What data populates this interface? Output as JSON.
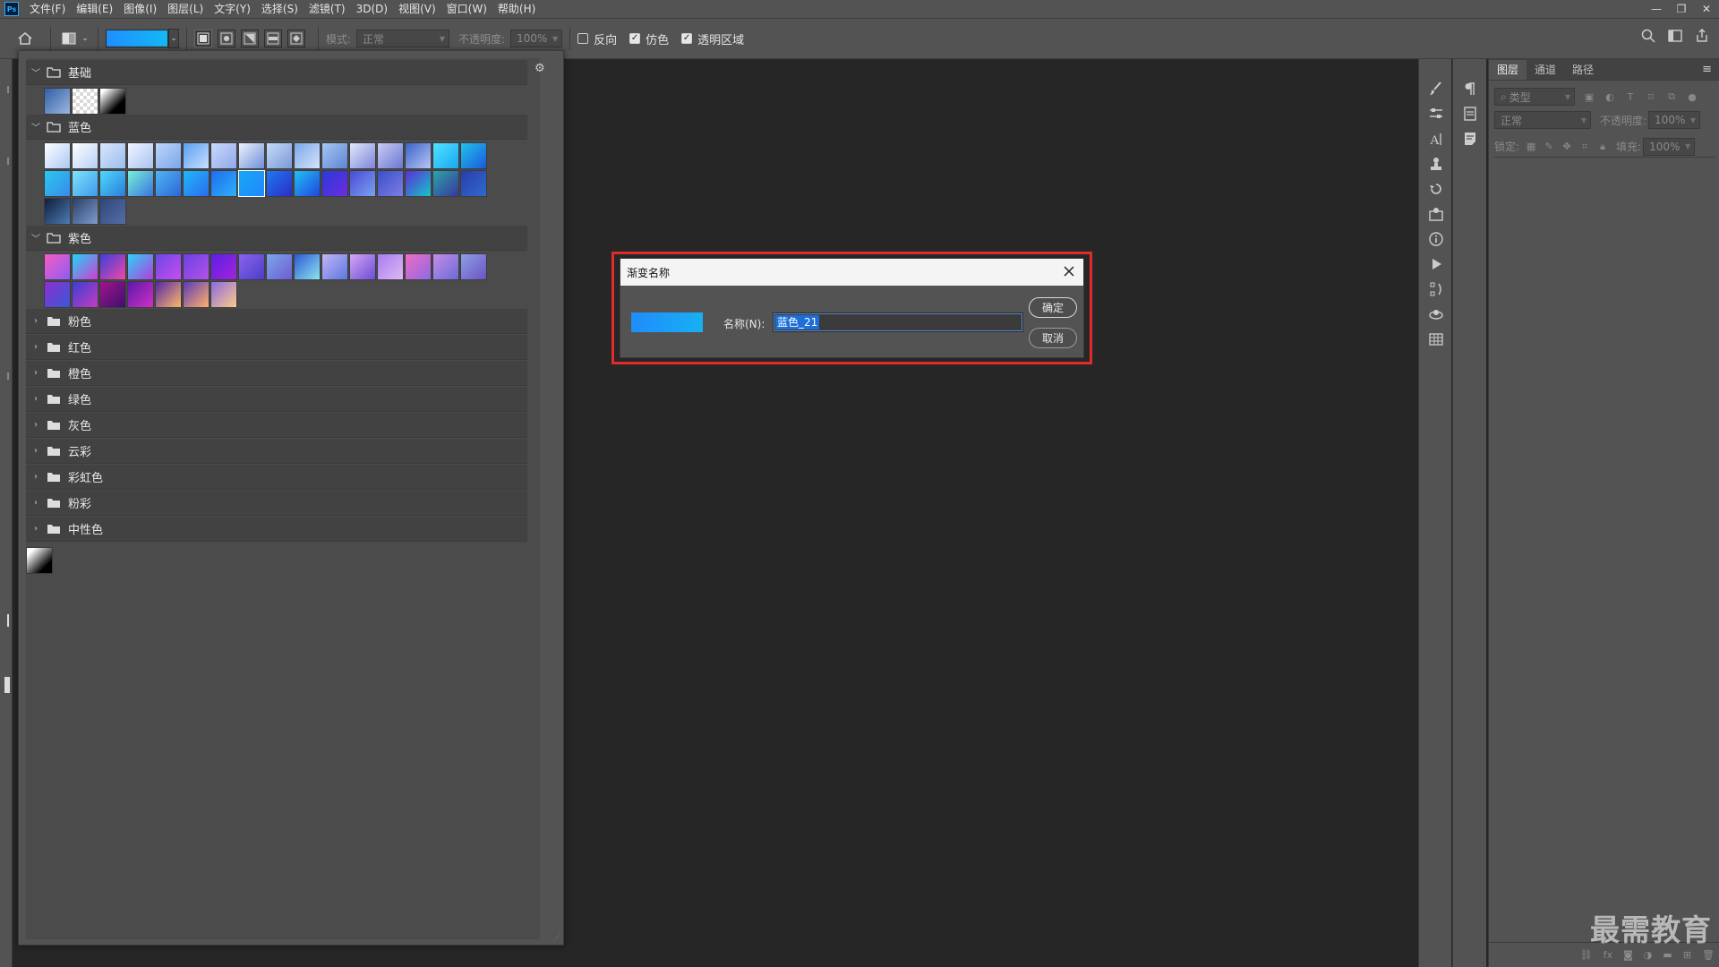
{
  "app": {
    "logo": "Ps"
  },
  "menu": [
    "文件(F)",
    "编辑(E)",
    "图像(I)",
    "图层(L)",
    "文字(Y)",
    "选择(S)",
    "滤镜(T)",
    "3D(D)",
    "视图(V)",
    "窗口(W)",
    "帮助(H)"
  ],
  "window_controls": {
    "minimize": "—",
    "restore": "❐",
    "close": "✕"
  },
  "options": {
    "mode_label": "模式:",
    "mode_value": "正常",
    "opacity_label": "不透明度:",
    "opacity_value": "100%",
    "reverse_label": "反向",
    "reverse_checked": false,
    "dither_label": "仿色",
    "dither_checked": true,
    "transparency_label": "透明区域",
    "transparency_checked": true,
    "gradient_colors": [
      "#1e8fff",
      "#15b8f5"
    ]
  },
  "gradient_panel": {
    "groups": [
      {
        "name": "基础",
        "expanded": true
      },
      {
        "name": "蓝色",
        "expanded": true
      },
      {
        "name": "紫色",
        "expanded": true
      },
      {
        "name": "粉色",
        "expanded": false
      },
      {
        "name": "红色",
        "expanded": false
      },
      {
        "name": "橙色",
        "expanded": false
      },
      {
        "name": "绿色",
        "expanded": false
      },
      {
        "name": "灰色",
        "expanded": false
      },
      {
        "name": "云彩",
        "expanded": false
      },
      {
        "name": "彩虹色",
        "expanded": false
      },
      {
        "name": "粉彩",
        "expanded": false
      },
      {
        "name": "中性色",
        "expanded": false
      }
    ],
    "basic_swatches": [
      "linear-gradient(135deg,#2f5fa8,#9fb6dd)",
      "repeating-conic-gradient(#d9d9d9 0 25%,#ffffff 0 50%) 0 0/8px 8px",
      "linear-gradient(135deg,#ffffff 10%,#000000 70%)"
    ],
    "blue_swatches": [
      [
        "linear-gradient(135deg,#ffffff,#aac8f4)",
        "linear-gradient(135deg,#ffffff,#b7cff5)",
        "linear-gradient(135deg,#d8e6fb,#9dbcf0)",
        "linear-gradient(135deg,#f0f5ff,#a9c3f2)",
        "linear-gradient(135deg,#bcd6fa,#7ca6ea)",
        "linear-gradient(135deg,#5d9ff2,#c7e0ff)",
        "linear-gradient(135deg,#cad8fb,#8fa9ea)",
        "linear-gradient(135deg,#eef3fd,#6f8fd8)",
        "linear-gradient(135deg,#c5dcf6,#7998d8)",
        "linear-gradient(135deg,#7ba7ea,#d6e4fb)",
        "linear-gradient(135deg,#a8c7f5,#5c84d2)",
        "linear-gradient(135deg,#e0e8fb,#7c86d9)",
        "linear-gradient(135deg,#c8cbf4,#6b78d2)",
        "linear-gradient(135deg,#3b62c8,#b8c6f2)",
        "linear-gradient(135deg,#4fe3ff,#1aa7f2)",
        "linear-gradient(135deg,#21c2ef,#1a5ad8)"
      ],
      [
        "linear-gradient(135deg,#28c8f0,#3a8ae8)",
        "linear-gradient(135deg,#7fe3f8,#3c9af0)",
        "linear-gradient(135deg,#4ed9f7,#2a7de0)",
        "linear-gradient(135deg,#76f0d8,#3a74e0)",
        "linear-gradient(135deg,#4db6f5,#2f65d6)",
        "linear-gradient(135deg,#1fb8f5,#2b6cf0)",
        "linear-gradient(135deg,#1d6cf0,#2fb1f8)",
        "linear-gradient(135deg,#18a6f4,#2089ff)",
        "linear-gradient(135deg,#1d7af0,#2b2cc8)",
        "linear-gradient(135deg,#22c0f4,#1f46e0)",
        "linear-gradient(135deg,#2a39d8,#6d2ce0)",
        "linear-gradient(135deg,#4a4ad6,#7aa2ee)",
        "linear-gradient(135deg,#3a50c4,#7d7de8)",
        "linear-gradient(135deg,#5d2dd6,#16c5c8)",
        "linear-gradient(135deg,#2aa6a8,#38379e)",
        "linear-gradient(135deg,#2a3da8,#2f6ad0)"
      ],
      [
        "linear-gradient(135deg,#0f1f3c,#4e7bb4)",
        "linear-gradient(135deg,#2b3f66,#7d9ccd)",
        "linear-gradient(135deg,#2d4678,#566ea8)"
      ]
    ],
    "purple_swatches": [
      [
        "linear-gradient(135deg,#f65cc4,#8e5cf2)",
        "linear-gradient(135deg,#1fd6f5,#d23ad2)",
        "linear-gradient(135deg,#3c3fd8,#f047a8)",
        "linear-gradient(135deg,#2fd2f5,#b23cde)",
        "linear-gradient(135deg,#6a48e2,#c94cf2)",
        "linear-gradient(135deg,#6d3fe6,#b254e6)",
        "linear-gradient(135deg,#5c1fe6,#a424d8)",
        "linear-gradient(135deg,#8a64ee,#4c3cc8)",
        "linear-gradient(135deg,#7da6e8,#6b5dd4)",
        "linear-gradient(135deg,#2c5ad4,#8ee3f0)",
        "linear-gradient(135deg,#c2b4f6,#5c78e0)",
        "linear-gradient(135deg,#d6a6f2,#6a4cd8)",
        "linear-gradient(135deg,#a57ef0,#dfb7f6)",
        "linear-gradient(135deg,#f06cc2,#8d6ae4)",
        "linear-gradient(135deg,#c48ee8,#6d6ad8)",
        "linear-gradient(135deg,#8da0e6,#6a52c4)"
      ],
      [
        "linear-gradient(135deg,#8c2fd0,#3a58d8)",
        "linear-gradient(135deg,#3b3fd0,#c43cc4)",
        "linear-gradient(135deg,#a0158c,#3d0f6e)",
        "linear-gradient(135deg,#5a1aa8,#d22fc8)",
        "linear-gradient(135deg,#5328a8,#ffb868)",
        "linear-gradient(135deg,#5b3ab8,#ffb26a)",
        "linear-gradient(135deg,#8a6be0,#ffc98a)"
      ]
    ],
    "neutral_swatch": "linear-gradient(135deg,#ffffff 15%,#000000 75%)",
    "gear": "⚙"
  },
  "dialog": {
    "title": "渐变名称",
    "name_label": "名称(N):",
    "name_value": "蓝色_21",
    "ok": "确定",
    "cancel": "取消"
  },
  "layers_panel": {
    "tabs": [
      "图层",
      "通道",
      "路径"
    ],
    "filter_placeholder": "类型",
    "blend_mode": "正常",
    "opacity_label": "不透明度:",
    "opacity_value": "100%",
    "lock_label": "锁定:",
    "fill_label": "填充:",
    "fill_value": "100%",
    "bottom_icons": [
      "link-icon",
      "fx",
      "mask-icon",
      "adjustment-icon",
      "folder-icon",
      "new-layer-icon",
      "trash-icon"
    ]
  },
  "watermark": "最需教育"
}
